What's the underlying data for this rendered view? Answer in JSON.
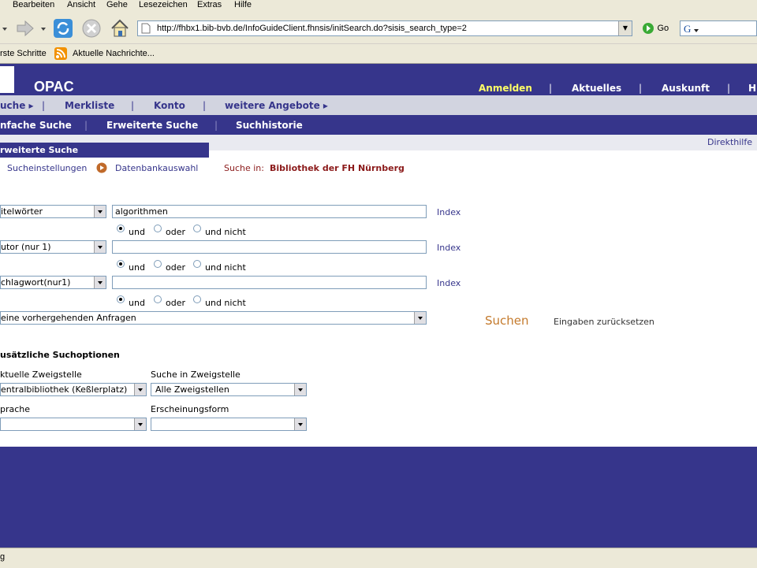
{
  "browser": {
    "menu": [
      "Bearbeiten",
      "Ansicht",
      "Gehe",
      "Lesezeichen",
      "Extras",
      "Hilfe"
    ],
    "url": "http://fhbx1.bib-bvb.de/InfoGuideClient.fhnsis/initSearch.do?sisis_search_type=2",
    "go_label": "Go",
    "bookmarks": [
      "rste Schritte",
      "Aktuelle Nachrichte..."
    ],
    "status_text": "g"
  },
  "header": {
    "title": "OPAC",
    "nav": [
      "Anmelden",
      "Aktuelles",
      "Auskunft",
      "Hi"
    ],
    "active_color": "#ffff66"
  },
  "main_nav": {
    "items": [
      "uche",
      "Merkliste",
      "Konto",
      "weitere Angebote"
    ]
  },
  "sub_nav": {
    "items": [
      "nfache Suche",
      "Erweiterte Suche",
      "Suchhistorie"
    ]
  },
  "help_link": "Direkthilfe",
  "section_title": "rweiterte Suche",
  "tabs": {
    "settings": "Sucheinstellungen",
    "db": "Datenbankauswahl",
    "search_in_label": "Suche in:",
    "search_in_value": "Bibliothek der FH Nürnberg"
  },
  "search_rows": [
    {
      "field": "itelwörter",
      "value": "algorithmen",
      "index": "Index"
    },
    {
      "field": "utor (nur 1)",
      "value": "",
      "index": "Index"
    },
    {
      "field": "chlagwort(nur1)",
      "value": "",
      "index": "Index"
    }
  ],
  "operators": {
    "und": "und",
    "oder": "oder",
    "und_nicht": "und nicht"
  },
  "previous_queries": "eine vorhergehenden Anfragen",
  "actions": {
    "search": "Suchen",
    "reset": "Eingaben zurücksetzen"
  },
  "options": {
    "title": "usätzliche Suchoptionen",
    "current_branch_label": "ktuelle Zweigstelle",
    "current_branch_value": "entralbibliothek (Keßlerplatz)",
    "search_branch_label": "Suche in Zweigstelle",
    "search_branch_value": "Alle Zweigstellen",
    "language_label": "prache",
    "language_value": "",
    "form_label": "Erscheinungsform",
    "form_value": ""
  },
  "colors": {
    "brand": "#36358b",
    "accent": "#c47a2c",
    "highlight_text": "#8b1a1a"
  }
}
